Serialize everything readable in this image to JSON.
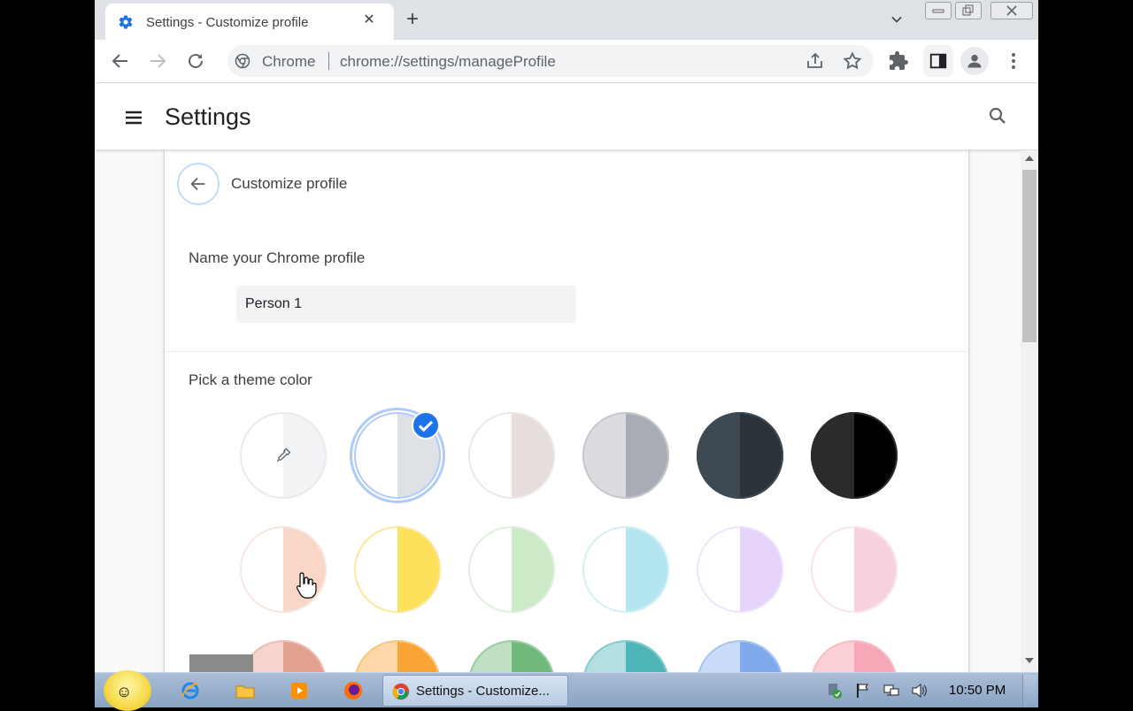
{
  "tab": {
    "title": "Settings - Customize profile",
    "close": "✕",
    "new_tab": "+"
  },
  "omnibox": {
    "chip": "Chrome",
    "url": "chrome://settings/manageProfile"
  },
  "header": {
    "title": "Settings"
  },
  "subpage": {
    "title": "Customize profile"
  },
  "profile_name": {
    "label": "Name your Chrome profile",
    "value": "Person 1"
  },
  "theme": {
    "label": "Pick a theme color",
    "selected": "Default",
    "rows": [
      [
        {
          "left": "#ffffff",
          "right": "#f1f3f4",
          "ring": "#e8eaed",
          "kind": "custom"
        },
        {
          "left": "#ffffff",
          "right": "#dee1e6",
          "ring": "#aecbfa",
          "kind": "selected"
        },
        {
          "left": "#ffffff",
          "right": "#e6dedb",
          "ring": "#ede8e6",
          "kind": "normal"
        },
        {
          "left": "#dadce0",
          "right": "#a8adb5",
          "ring": "#c4c7cc",
          "kind": "normal"
        },
        {
          "left": "#3d4a54",
          "right": "#2b3238",
          "ring": "#3d4a54",
          "kind": "normal"
        },
        {
          "left": "#2b2b2b",
          "right": "#000000",
          "ring": "#2b2b2b",
          "kind": "normal"
        }
      ],
      [
        {
          "left": "#ffffff",
          "right": "#f9d6c6",
          "ring": "#f5e6df",
          "kind": "normal"
        },
        {
          "left": "#ffffff",
          "right": "#fde05b",
          "ring": "#f9e79a",
          "kind": "normal"
        },
        {
          "left": "#ffffff",
          "right": "#cbeac5",
          "ring": "#dff0dc",
          "kind": "normal"
        },
        {
          "left": "#ffffff",
          "right": "#b3e6f0",
          "ring": "#d2eef4",
          "kind": "normal"
        },
        {
          "left": "#ffffff",
          "right": "#e6d4fb",
          "ring": "#eee4fb",
          "kind": "normal"
        },
        {
          "left": "#ffffff",
          "right": "#f6d2e1",
          "ring": "#f8e3ec",
          "kind": "normal"
        }
      ],
      [
        {
          "left": "#f4d4cd",
          "right": "#e2a08e",
          "ring": "#ebbcb0",
          "kind": "normal"
        },
        {
          "left": "#fcd8a8",
          "right": "#f9a435",
          "ring": "#fbc47a",
          "kind": "normal"
        },
        {
          "left": "#bfe0c2",
          "right": "#6fb97c",
          "ring": "#9acda3",
          "kind": "normal"
        },
        {
          "left": "#b4dfe0",
          "right": "#4eb6b8",
          "ring": "#86cbcc",
          "kind": "normal"
        },
        {
          "left": "#c9dcf7",
          "right": "#7faaeb",
          "ring": "#a6c3f1",
          "kind": "normal"
        },
        {
          "left": "#fbd0d7",
          "right": "#f6a8b6",
          "ring": "#f8bcc6",
          "kind": "normal"
        }
      ]
    ]
  },
  "taskbar": {
    "active_window": "Settings - Customize...",
    "clock": "10:50 PM"
  },
  "colors": {
    "accent": "#1a73e8",
    "chrome_red": "#db4437",
    "chrome_green": "#0f9d58",
    "chrome_yellow": "#f4b400"
  }
}
